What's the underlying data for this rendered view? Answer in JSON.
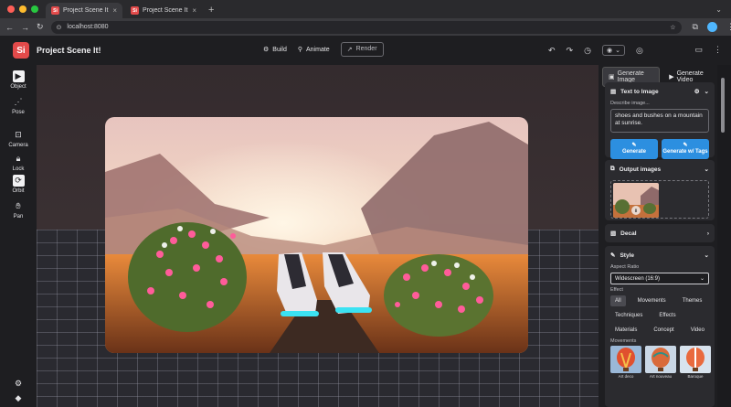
{
  "browser": {
    "tabs": [
      {
        "icon_text": "Si",
        "title": "Project Scene It!",
        "active": true
      },
      {
        "icon_text": "Si",
        "title": "Project Scene It!",
        "active": false
      }
    ],
    "url": "localhost:8080"
  },
  "app": {
    "logo_text": "Si",
    "name": "Project Scene It!",
    "actions": {
      "build": "Build",
      "animate": "Animate",
      "render": "Render"
    }
  },
  "tools": [
    {
      "label": "Object"
    },
    {
      "label": "Pose"
    },
    {
      "label": "Camera"
    },
    {
      "label": "Lock"
    },
    {
      "label": "Orbit"
    },
    {
      "label": "Pan"
    }
  ],
  "panel": {
    "tabs": {
      "image": "Generate Image",
      "video": "Generate Video"
    },
    "text_to_image": {
      "title": "Text to Image",
      "describe_label": "Describe image...",
      "prompt": "shoes and bushes on a mountain at sunrise.",
      "generate": "Generate",
      "generate_tags": "Generate w/ Tags"
    },
    "output": {
      "title": "Output images"
    },
    "decal": {
      "title": "Decal"
    },
    "style": {
      "title": "Style",
      "aspect_label": "Aspect Ratio",
      "aspect_value": "Widescreen (16:9)",
      "effect_label": "Effect",
      "chips": [
        "All",
        "Movements",
        "Themes",
        "Techniques",
        "Effects",
        "Materials",
        "Concept",
        "Video"
      ],
      "movements_label": "Movements",
      "movements": [
        "Art deco",
        "Art nouveau",
        "Baroque"
      ]
    }
  },
  "colors": {
    "accent": "#2c8fe0",
    "brand": "#e34a4a"
  }
}
